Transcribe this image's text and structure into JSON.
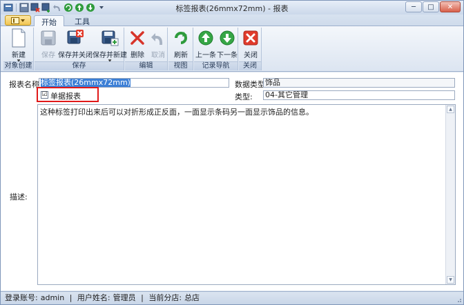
{
  "window": {
    "title": "标签报表(26mmx72mm) - 报表",
    "controls": {
      "minimize": "─",
      "maximize": "□",
      "close": "✕"
    }
  },
  "tabs": [
    {
      "label": "开始",
      "active": true
    },
    {
      "label": "工具",
      "active": false
    }
  ],
  "ribbon": {
    "groups": [
      {
        "label": "对象创建",
        "buttons": [
          {
            "label": "新建",
            "icon": "new-document-icon",
            "enabled": true
          }
        ]
      },
      {
        "label": "保存",
        "buttons": [
          {
            "label": "保存",
            "icon": "save-icon",
            "enabled": false
          },
          {
            "label": "保存并关闭",
            "icon": "save-close-icon",
            "enabled": true
          },
          {
            "label": "保存并新建",
            "icon": "save-new-icon",
            "enabled": true
          }
        ]
      },
      {
        "label": "编辑",
        "buttons": [
          {
            "label": "删除",
            "icon": "delete-icon",
            "enabled": true
          },
          {
            "label": "取消",
            "icon": "undo-icon",
            "enabled": false
          }
        ]
      },
      {
        "label": "视图",
        "buttons": [
          {
            "label": "刷新",
            "icon": "refresh-icon",
            "enabled": true
          }
        ]
      },
      {
        "label": "记录导航",
        "buttons": [
          {
            "label": "上一条",
            "icon": "arrow-up-icon",
            "enabled": true
          },
          {
            "label": "下一条",
            "icon": "arrow-down-icon",
            "enabled": true
          }
        ]
      },
      {
        "label": "关闭",
        "buttons": [
          {
            "label": "关闭",
            "icon": "close-icon",
            "enabled": true
          }
        ]
      }
    ]
  },
  "form": {
    "report_name_label": "报表名称:",
    "report_name_value": "标签报表(26mmx72mm)",
    "data_type_label": "数据类型:",
    "data_type_value": "饰品",
    "single_report_label": "单据报表",
    "single_report_checked": "☑",
    "type_label": "类型:",
    "type_value": "04-其它管理",
    "description_label": "描述:",
    "description_value": "这种标签打印出来后可以对折形成正反面，一面显示条码另一面显示饰品的信息。"
  },
  "status": {
    "login_label": "登录账号:",
    "login_value": "admin",
    "user_label": "用户姓名:",
    "user_value": "管理员",
    "branch_label": "当前分店:",
    "branch_value": "总店",
    "separator": "|"
  },
  "colors": {
    "accent": "#3c7fd6",
    "highlight_box": "#e01818",
    "close_red": "#d8604a"
  }
}
